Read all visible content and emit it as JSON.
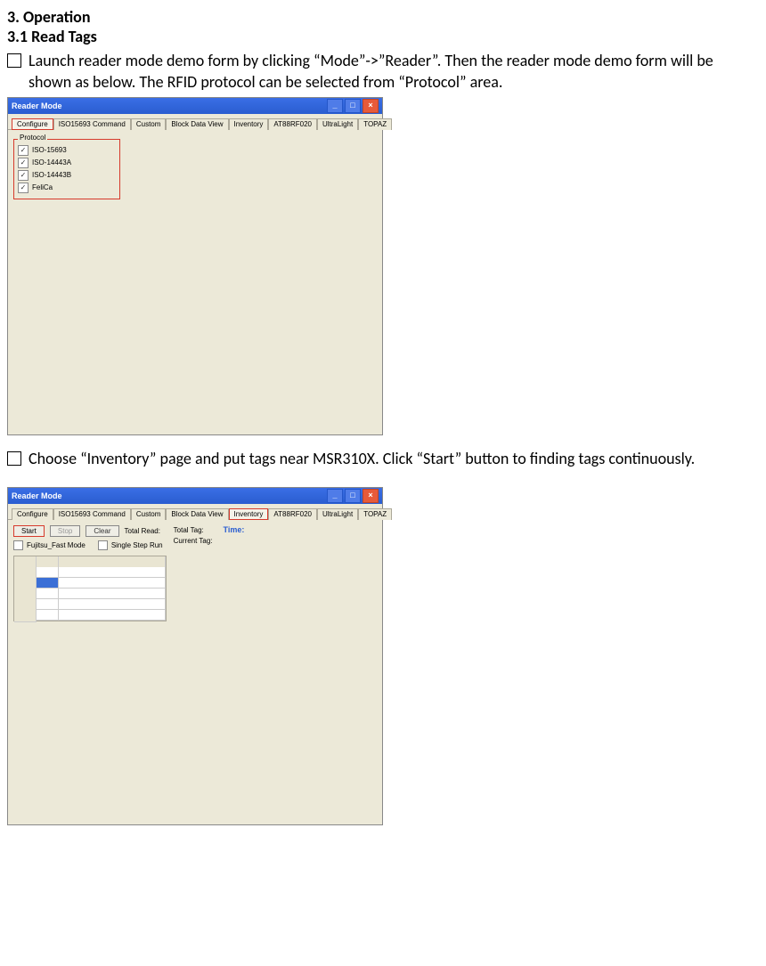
{
  "headings": {
    "h1": "3. Operation",
    "h2": "3.1 Read Tags"
  },
  "bullets": {
    "b1": "Launch reader mode demo form by clicking “Mode”->”Reader”. Then the reader mode demo form will be shown as below. The RFID protocol can be selected from “Protocol” area.",
    "b2": "Choose “Inventory” page and put tags near MSR310X. Click “Start” button to finding tags continuously."
  },
  "win": {
    "title": "Reader Mode",
    "tabs": {
      "configure": "Configure",
      "iso15693cmd": "ISO15693 Command",
      "custom": "Custom",
      "blockdata": "Block Data View",
      "inventory": "Inventory",
      "at88rf020": "AT88RF020",
      "ultralight": "UltraLight",
      "topaz": "TOPAZ"
    },
    "protocol": {
      "legend": "Protocol",
      "iso15693": "ISO-15693",
      "iso14443a": "ISO-14443A",
      "iso14443b": "ISO-14443B",
      "felica": "FeliCa"
    },
    "inv": {
      "start": "Start",
      "stop": "Stop",
      "clear": "Clear",
      "totalread": "Total Read:",
      "totaltag": "Total Tag:",
      "currenttag": "Current Tag:",
      "time": "Time:",
      "fujitsu": "Fujitsu_Fast Mode",
      "singlestep": "Single Step Run"
    }
  }
}
